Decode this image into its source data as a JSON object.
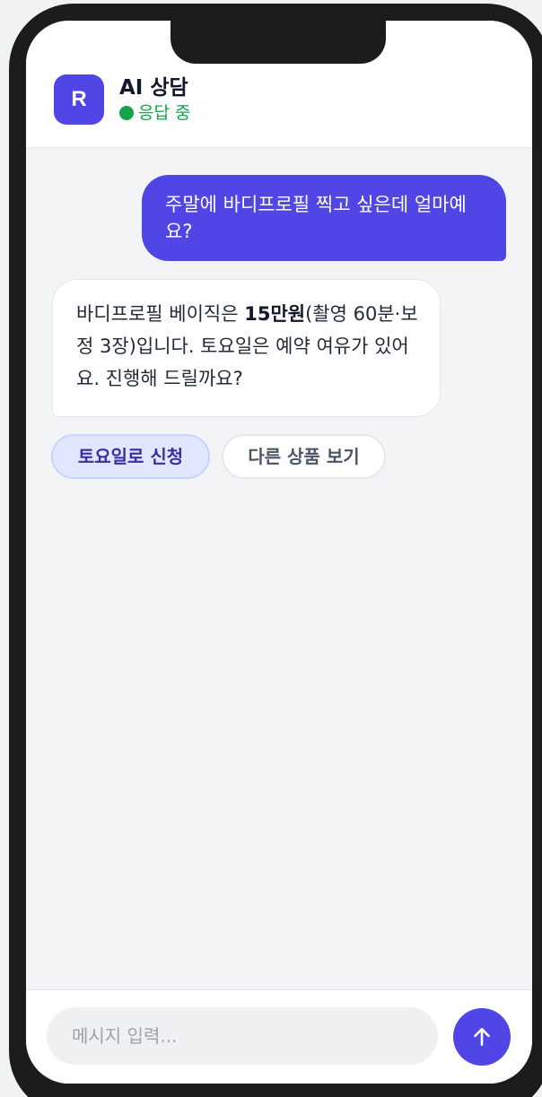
{
  "header": {
    "avatar_letter": "R",
    "title": "AI 상담",
    "status": "응답 중"
  },
  "messages": [
    {
      "role": "user",
      "text": "주말에 바디프로필 찍고 싶은데 얼마예요?"
    },
    {
      "role": "assistant",
      "text_before": "바디프로필 베이직은 ",
      "text_bold": "15만원",
      "text_after": "(촬영 60분·보정 3장)입니다. 토요일은 예약 여유가 있어요. 진행해 드릴까요?"
    }
  ],
  "quick_replies": [
    "토요일로 신청",
    "다른 상품 보기"
  ],
  "composer": {
    "placeholder": "메시지 입력...",
    "send_icon": "arrow-up-icon"
  },
  "colors": {
    "accent": "#4f46e5",
    "status": "#16a34a",
    "chip_primary_bg": "#e0e7ff",
    "chip_primary_text": "#3730a3"
  }
}
